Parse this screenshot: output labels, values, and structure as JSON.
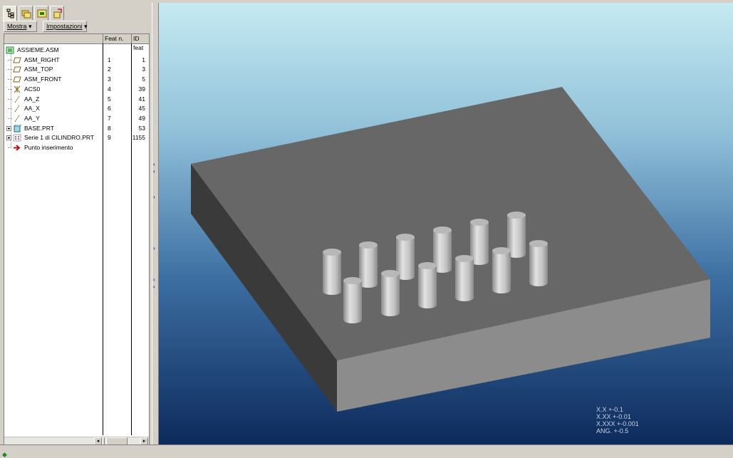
{
  "toolbar": {
    "show_label": "Mostra",
    "settings_label": "Impostazioni"
  },
  "tree_header": {
    "feat_num": "Feat n.",
    "feat_id": "ID feat"
  },
  "tree_rows": [
    {
      "label": "ASSIEME.ASM",
      "num": "",
      "id": "",
      "icon": "assembly-icon"
    },
    {
      "label": "ASM_RIGHT",
      "num": "1",
      "id": "1",
      "icon": "datum-plane-icon"
    },
    {
      "label": "ASM_TOP",
      "num": "2",
      "id": "3",
      "icon": "datum-plane-icon"
    },
    {
      "label": "ASM_FRONT",
      "num": "3",
      "id": "5",
      "icon": "datum-plane-icon"
    },
    {
      "label": "ACS0",
      "num": "4",
      "id": "39",
      "icon": "coordinate-system-icon"
    },
    {
      "label": "AA_Z",
      "num": "5",
      "id": "41",
      "icon": "datum-axis-icon"
    },
    {
      "label": "AA_X",
      "num": "6",
      "id": "45",
      "icon": "datum-axis-icon"
    },
    {
      "label": "AA_Y",
      "num": "7",
      "id": "49",
      "icon": "datum-axis-icon"
    },
    {
      "label": "BASE.PRT",
      "num": "8",
      "id": "53",
      "icon": "part-icon"
    },
    {
      "label": "Serie 1 di CILINDRO.PRT",
      "num": "9",
      "id": "1155",
      "icon": "pattern-icon"
    },
    {
      "label": "Punto inserimento",
      "num": "",
      "id": "",
      "icon": "insert-arrow-icon"
    }
  ],
  "tolerances": [
    "X.X +-0.1",
    "X.XX +-0.01",
    "X.XXX +-0.001",
    "ANG. +-0.5"
  ],
  "colors": {
    "viewport_top": "#c5eaf2",
    "viewport_bottom": "#0d2a5c",
    "part_top": "#676767",
    "part_front": "#8c8c8c",
    "part_side": "#3a3a3a"
  }
}
